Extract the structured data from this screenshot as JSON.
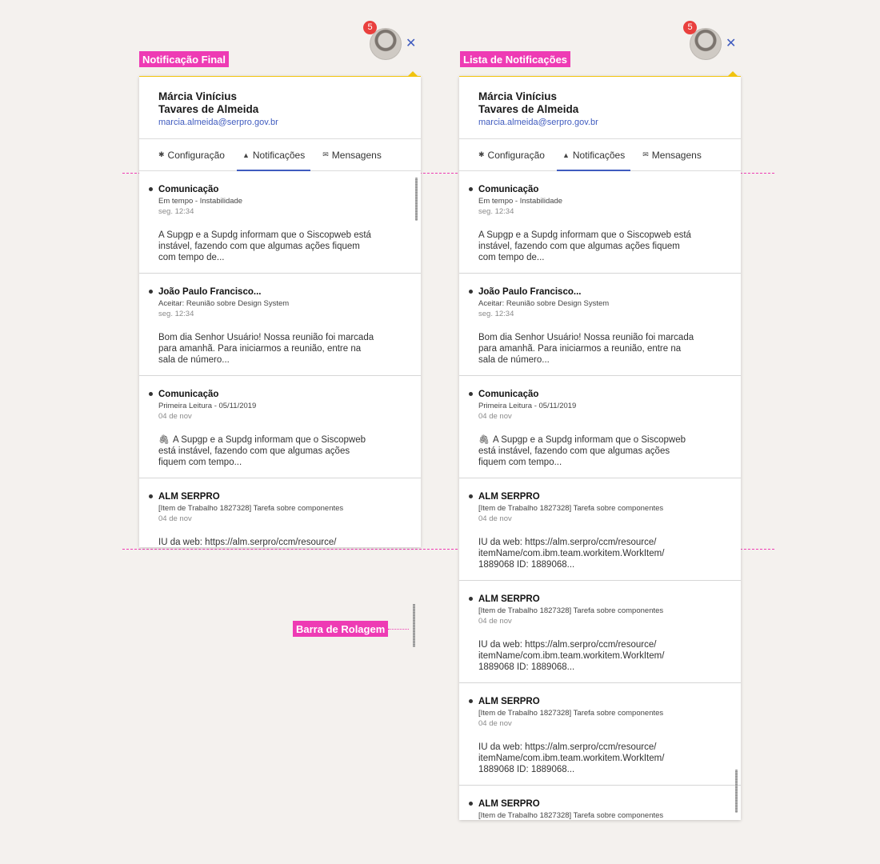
{
  "labels": {
    "final": "Notificação Final",
    "list": "Lista de Notificações",
    "scrollbar": "Barra de Rolagem"
  },
  "badge_count": "5",
  "close_glyph": "✕",
  "user": {
    "name_line1": "Márcia Vinícius",
    "name_line2": "Tavares de Almeida",
    "email": "marcia.almeida@serpro.gov.br"
  },
  "tabs": [
    {
      "icon": "gear-icon",
      "glyph": "✱",
      "label": "Configuração"
    },
    {
      "icon": "bell-icon",
      "glyph": "▲",
      "label": "Notificações"
    },
    {
      "icon": "envelope-icon",
      "glyph": "✉",
      "label": "Mensagens"
    }
  ],
  "notifications": [
    {
      "title": "Comunicação",
      "subtitle": "Em tempo - Instabilidade",
      "time": "seg. 12:34",
      "body": "A Supgp e a Supdg informam que o Siscopweb está\ninstável, fazendo com que algumas ações fiquem\ncom tempo de..."
    },
    {
      "title": "João Paulo Francisco...",
      "subtitle": "Aceitar: Reunião sobre Design System",
      "time": "seg. 12:34",
      "body": "Bom dia Senhor Usuário!  Nossa reunião foi marcada\npara amanhã. Para iniciarmos a reunião, entre na\nsala de número..."
    },
    {
      "title": "Comunicação",
      "subtitle": "Primeira Leitura - 05/11/2019",
      "time": "04 de nov",
      "attachment": true,
      "body": "A Supgp e a Supdg informam que o Siscopweb\nestá instável, fazendo com que algumas ações\nfiquem com tempo..."
    },
    {
      "title": "ALM SERPRO",
      "subtitle": "[Item de Trabalho 1827328] Tarefa sobre componentes",
      "time": "04 de nov",
      "body": "IU da web: https://alm.serpro/ccm/resource/\nitemName/com.ibm.team.workitem.WorkItem/\n1889068 ID: 1889068..."
    },
    {
      "title": "ALM SERPRO",
      "subtitle": "[Item de Trabalho 1827328] Tarefa sobre componentes",
      "time": "04 de nov",
      "body": "IU da web: https://alm.serpro/ccm/resource/\nitemName/com.ibm.team.workitem.WorkItem/\n1889068 ID: 1889068..."
    },
    {
      "title": "ALM SERPRO",
      "subtitle": "[Item de Trabalho 1827328] Tarefa sobre componentes",
      "time": "04 de nov",
      "body": "IU da web: https://alm.serpro/ccm/resource/\nitemName/com.ibm.team.workitem.WorkItem/\n1889068 ID: 1889068..."
    },
    {
      "title": "ALM SERPRO",
      "subtitle": "[Item de Trabalho 1827328] Tarefa sobre componentes",
      "time": "",
      "body": ""
    }
  ],
  "colors": {
    "accent_blue": "#3f5bbf",
    "annotation_pink": "#ee3bb4",
    "panel_top_yellow": "#f1c40f",
    "badge_red": "#e9403e"
  }
}
